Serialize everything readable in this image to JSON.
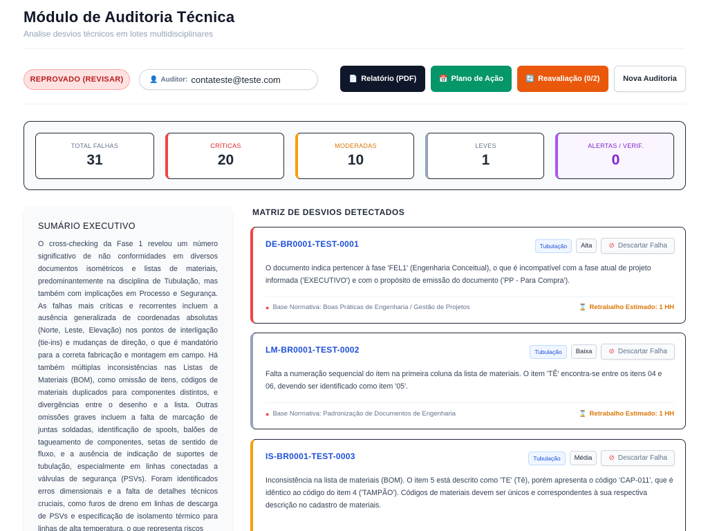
{
  "header": {
    "title": "Módulo de Auditoria Técnica",
    "subtitle": "Analise desvios técnicos em lotes multidisciplinares"
  },
  "toolbar": {
    "status": "REPROVADO (REVISAR)",
    "auditor_label": "Auditor:",
    "auditor_value": "contateste@teste.com",
    "report_button": "Relatório (PDF)",
    "plan_button": "Plano de Ação",
    "reeval_button": "Reavaliação (0/2)",
    "new_button": "Nova Auditoria"
  },
  "stats": {
    "total": {
      "label": "TOTAL FALHAS",
      "value": "31"
    },
    "critical": {
      "label": "CRÍTICAS",
      "value": "20"
    },
    "moderate": {
      "label": "MODERADAS",
      "value": "10"
    },
    "light": {
      "label": "LEVES",
      "value": "1"
    },
    "alerts": {
      "label": "ALERTAS / VERIF.",
      "value": "0"
    }
  },
  "summary": {
    "title": "SUMÁRIO EXECUTIVO",
    "text": "O cross-checking da Fase 1 revelou um número significativo de não conformidades em diversos documentos isométricos e listas de materiais, predominantemente na disciplina de Tubulação, mas também com implicações em Processo e Segurança. As falhas mais críticas e recorrentes incluem a ausência generalizada de coordenadas absolutas (Norte, Leste, Elevação) nos pontos de interligação (tie-ins) e mudanças de direção, o que é mandatório para a correta fabricação e montagem em campo. Há também múltiplas inconsistências nas Listas de Materiais (BOM), como omissão de itens, códigos de materiais duplicados para componentes distintos, e divergências entre o desenho e a lista. Outras omissões graves incluem a falta de marcação de juntas soldadas, identificação de spools, balões de tagueamento de componentes, setas de sentido de fluxo, e a ausência de indicação de suportes de tubulação, especialmente em linhas conectadas a válvulas de segurança (PSVs). Foram identificados erros dimensionais e a falta de detalhes técnicos cruciais, como furos de dreno em linhas de descarga de PSVs e especificação de isolamento térmico para linhas de alta temperatura, o que representa riscos"
  },
  "matrix": {
    "title": "MATRIZ DE DESVIOS DETECTADOS",
    "discard_label": "Descartar Falha",
    "basis_prefix": "Base Normativa:",
    "rework_prefix": "Retrabalho Estimado:",
    "items": [
      {
        "id": "DE-BR0001-TEST-0001",
        "discipline": "Tubulação",
        "severity": "Alta",
        "description": "O documento indica pertencer à fase 'FEL1' (Engenharia Conceitual), o que é incompatível com a fase atual de projeto informada ('EXECUTIVO') e com o propósito de emissão do documento ('PP - Para Compra').",
        "basis": "Base Normativa: Boas Práticas de Engenharia / Gestão de Projetos",
        "rework": "Retrabalho Estimado: 1 HH"
      },
      {
        "id": "LM-BR0001-TEST-0002",
        "discipline": "Tubulação",
        "severity": "Baixa",
        "description": "Falta a numeração sequencial do item na primeira coluna da lista de materiais. O item 'TÊ' encontra-se entre os itens 04 e 06, devendo ser identificado como item '05'.",
        "basis": "Base Normativa: Padronização de Documentos de Engenharia",
        "rework": "Retrabalho Estimado: 1 HH"
      },
      {
        "id": "IS-BR0001-TEST-0003",
        "discipline": "Tubulação",
        "severity": "Média",
        "description": "Inconsistência na lista de materiais (BOM). O item 5 está descrito como 'TE' (Tê), porém apresenta o código 'CAP-011', que é idêntico ao código do item 4 ('TAMPÃO'). Códigos de materiais devem ser únicos e correspondentes à sua respectiva descrição no cadastro de materiais."
      }
    ]
  },
  "colors": {
    "critical": "#ef4444",
    "moderate": "#f59e0b",
    "light": "#94a3b8",
    "alert": "#a855f7",
    "plan_button": "#059669",
    "reeval_button": "#ea580c",
    "report_button": "#0f172a",
    "link_blue": "#1d4ed8"
  },
  "icons": {
    "auditor": "user-icon",
    "report": "document-icon",
    "plan": "calendar-icon",
    "reeval": "refresh-icon",
    "discard": "ban-icon",
    "basis": "pin-icon",
    "rework": "hourglass-icon"
  }
}
